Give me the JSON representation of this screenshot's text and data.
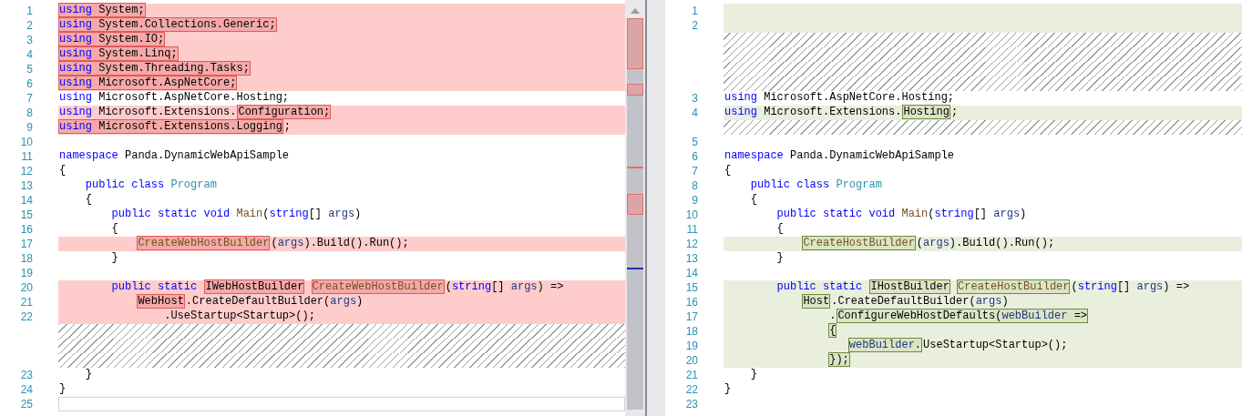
{
  "panes": [
    {
      "kind": "old",
      "lines": [
        {
          "kind": "removed",
          "num": "1",
          "segments": [
            {
              "changed": true,
              "tokens": [
                {
                  "t": "using",
                  "kind": "kw"
                },
                {
                  "t": " System;",
                  "kind": "plain"
                }
              ]
            }
          ]
        },
        {
          "kind": "removed",
          "num": "2",
          "segments": [
            {
              "changed": true,
              "tokens": [
                {
                  "t": "using",
                  "kind": "kw"
                },
                {
                  "t": " System.Collections.Generic;",
                  "kind": "plain"
                }
              ]
            }
          ]
        },
        {
          "kind": "removed",
          "num": "3",
          "segments": [
            {
              "changed": true,
              "tokens": [
                {
                  "t": "using",
                  "kind": "kw"
                },
                {
                  "t": " System.IO;",
                  "kind": "plain"
                }
              ]
            }
          ]
        },
        {
          "kind": "removed",
          "num": "4",
          "segments": [
            {
              "changed": true,
              "tokens": [
                {
                  "t": "using",
                  "kind": "kw"
                },
                {
                  "t": " System.Linq;",
                  "kind": "plain"
                }
              ]
            }
          ]
        },
        {
          "kind": "removed",
          "num": "5",
          "segments": [
            {
              "changed": true,
              "tokens": [
                {
                  "t": "using",
                  "kind": "kw"
                },
                {
                  "t": " System.Threading.Tasks;",
                  "kind": "plain"
                }
              ]
            }
          ]
        },
        {
          "kind": "removed",
          "num": "6",
          "segments": [
            {
              "changed": true,
              "tokens": [
                {
                  "t": "using",
                  "kind": "kw"
                },
                {
                  "t": " Microsoft.AspNetCore;",
                  "kind": "plain"
                }
              ]
            }
          ]
        },
        {
          "kind": "same",
          "num": "7",
          "segments": [
            {
              "changed": false,
              "tokens": [
                {
                  "t": "using",
                  "kind": "kw"
                },
                {
                  "t": " Microsoft.AspNetCore.Hosting;",
                  "kind": "plain"
                }
              ]
            }
          ]
        },
        {
          "kind": "removed",
          "num": "8",
          "segments": [
            {
              "changed": false,
              "tokens": [
                {
                  "t": "using",
                  "kind": "kw"
                },
                {
                  "t": " Microsoft.Extensions.",
                  "kind": "plain"
                }
              ]
            },
            {
              "changed": true,
              "tokens": [
                {
                  "t": "Configuration;",
                  "kind": "plain"
                }
              ]
            }
          ]
        },
        {
          "kind": "removed",
          "num": "9",
          "segments": [
            {
              "changed": true,
              "tokens": [
                {
                  "t": "using",
                  "kind": "kw"
                },
                {
                  "t": " Microsoft.Extensions.Logging",
                  "kind": "plain"
                }
              ]
            },
            {
              "changed": false,
              "tokens": [
                {
                  "t": ";",
                  "kind": "plain"
                }
              ]
            }
          ]
        },
        {
          "kind": "same",
          "num": "10"
        },
        {
          "kind": "same",
          "num": "11",
          "segments": [
            {
              "changed": false,
              "tokens": [
                {
                  "t": "namespace",
                  "kind": "kw"
                },
                {
                  "t": " Panda.DynamicWebApiSample",
                  "kind": "plain"
                }
              ]
            }
          ]
        },
        {
          "kind": "same",
          "num": "12",
          "segments": [
            {
              "changed": false,
              "tokens": [
                {
                  "t": "{",
                  "kind": "plain"
                }
              ]
            }
          ]
        },
        {
          "kind": "same",
          "num": "13",
          "segments": [
            {
              "changed": false,
              "tokens": [
                {
                  "t": "    public class ",
                  "kind": "kw"
                },
                {
                  "t": "Program",
                  "kind": "type"
                }
              ]
            }
          ]
        },
        {
          "kind": "same",
          "num": "14",
          "segments": [
            {
              "changed": false,
              "tokens": [
                {
                  "t": "    {",
                  "kind": "plain"
                }
              ]
            }
          ]
        },
        {
          "kind": "same",
          "num": "15",
          "segments": [
            {
              "changed": false,
              "tokens": [
                {
                  "t": "        public static void ",
                  "kind": "kw"
                },
                {
                  "t": "Main",
                  "kind": "method"
                },
                {
                  "t": "(",
                  "kind": "plain"
                },
                {
                  "t": "string",
                  "kind": "kw"
                },
                {
                  "t": "[] ",
                  "kind": "plain"
                },
                {
                  "t": "args",
                  "kind": "param"
                },
                {
                  "t": ")",
                  "kind": "plain"
                }
              ]
            }
          ]
        },
        {
          "kind": "same",
          "num": "16",
          "segments": [
            {
              "changed": false,
              "tokens": [
                {
                  "t": "        {",
                  "kind": "plain"
                }
              ]
            }
          ]
        },
        {
          "kind": "removed",
          "num": "17",
          "segments": [
            {
              "changed": true,
              "tokens": [
                {
                  "t": "            CreateWebHostBuilder",
                  "kind": "method"
                }
              ]
            },
            {
              "changed": false,
              "tokens": [
                {
                  "t": "(",
                  "kind": "plain"
                },
                {
                  "t": "args",
                  "kind": "param"
                },
                {
                  "t": ").Build().Run();",
                  "kind": "plain"
                }
              ]
            }
          ]
        },
        {
          "kind": "same",
          "num": "18",
          "segments": [
            {
              "changed": false,
              "tokens": [
                {
                  "t": "        }",
                  "kind": "plain"
                }
              ]
            }
          ]
        },
        {
          "kind": "same",
          "num": "19"
        },
        {
          "kind": "removed",
          "num": "20",
          "segments": [
            {
              "changed": false,
              "tokens": [
                {
                  "t": "        public static ",
                  "kind": "kw"
                }
              ]
            },
            {
              "changed": true,
              "tokens": [
                {
                  "t": "IWebHostBuilder",
                  "kind": "plain"
                }
              ]
            },
            {
              "changed": true,
              "tokens": [
                {
                  "t": " CreateWebHostBuilder",
                  "kind": "method"
                }
              ]
            },
            {
              "changed": false,
              "tokens": [
                {
                  "t": "(",
                  "kind": "plain"
                },
                {
                  "t": "string",
                  "kind": "kw"
                },
                {
                  "t": "[] ",
                  "kind": "plain"
                },
                {
                  "t": "args",
                  "kind": "param"
                },
                {
                  "t": ") =>",
                  "kind": "plain"
                }
              ]
            }
          ]
        },
        {
          "kind": "removed",
          "num": "21",
          "segments": [
            {
              "changed": true,
              "tokens": [
                {
                  "t": "            WebHost",
                  "kind": "plain"
                }
              ]
            },
            {
              "changed": false,
              "tokens": [
                {
                  "t": ".CreateDefaultBuilder(",
                  "kind": "plain"
                },
                {
                  "t": "args",
                  "kind": "param"
                },
                {
                  "t": ")",
                  "kind": "plain"
                }
              ]
            }
          ]
        },
        {
          "kind": "removed",
          "num": "22",
          "segments": [
            {
              "changed": false,
              "tokens": [
                {
                  "t": "                .UseStartup<Startup>();",
                  "kind": "plain"
                }
              ]
            }
          ]
        },
        {
          "kind": "filler"
        },
        {
          "kind": "filler"
        },
        {
          "kind": "filler"
        },
        {
          "kind": "same",
          "num": "23",
          "segments": [
            {
              "changed": false,
              "tokens": [
                {
                  "t": "    }",
                  "kind": "plain"
                }
              ]
            }
          ]
        },
        {
          "kind": "same",
          "num": "24",
          "segments": [
            {
              "changed": false,
              "tokens": [
                {
                  "t": "}",
                  "kind": "plain"
                }
              ]
            }
          ]
        },
        {
          "kind": "current",
          "num": "25"
        }
      ]
    },
    {
      "kind": "new",
      "lines": [
        {
          "kind": "added",
          "num": "1"
        },
        {
          "kind": "added",
          "num": "2"
        },
        {
          "kind": "filler"
        },
        {
          "kind": "filler"
        },
        {
          "kind": "filler"
        },
        {
          "kind": "filler"
        },
        {
          "kind": "same",
          "num": "3",
          "segments": [
            {
              "changed": false,
              "tokens": [
                {
                  "t": "using",
                  "kind": "kw"
                },
                {
                  "t": " Microsoft.AspNetCore.Hosting;",
                  "kind": "plain"
                }
              ]
            }
          ]
        },
        {
          "kind": "added",
          "num": "4",
          "segments": [
            {
              "changed": false,
              "tokens": [
                {
                  "t": "using",
                  "kind": "kw"
                },
                {
                  "t": " Microsoft.Extensions.",
                  "kind": "plain"
                }
              ]
            },
            {
              "changed": true,
              "tokens": [
                {
                  "t": "Hosting",
                  "kind": "plain"
                }
              ]
            },
            {
              "changed": false,
              "tokens": [
                {
                  "t": ";",
                  "kind": "plain"
                }
              ]
            }
          ]
        },
        {
          "kind": "filler"
        },
        {
          "kind": "same",
          "num": "5"
        },
        {
          "kind": "same",
          "num": "6",
          "segments": [
            {
              "changed": false,
              "tokens": [
                {
                  "t": "namespace",
                  "kind": "kw"
                },
                {
                  "t": " Panda.DynamicWebApiSample",
                  "kind": "plain"
                }
              ]
            }
          ]
        },
        {
          "kind": "same",
          "num": "7",
          "segments": [
            {
              "changed": false,
              "tokens": [
                {
                  "t": "{",
                  "kind": "plain"
                }
              ]
            }
          ]
        },
        {
          "kind": "same",
          "num": "8",
          "segments": [
            {
              "changed": false,
              "tokens": [
                {
                  "t": "    public class ",
                  "kind": "kw"
                },
                {
                  "t": "Program",
                  "kind": "type"
                }
              ]
            }
          ]
        },
        {
          "kind": "same",
          "num": "9",
          "segments": [
            {
              "changed": false,
              "tokens": [
                {
                  "t": "    {",
                  "kind": "plain"
                }
              ]
            }
          ]
        },
        {
          "kind": "same",
          "num": "10",
          "segments": [
            {
              "changed": false,
              "tokens": [
                {
                  "t": "        public static void ",
                  "kind": "kw"
                },
                {
                  "t": "Main",
                  "kind": "method"
                },
                {
                  "t": "(",
                  "kind": "plain"
                },
                {
                  "t": "string",
                  "kind": "kw"
                },
                {
                  "t": "[] ",
                  "kind": "plain"
                },
                {
                  "t": "args",
                  "kind": "param"
                },
                {
                  "t": ")",
                  "kind": "plain"
                }
              ]
            }
          ]
        },
        {
          "kind": "same",
          "num": "11",
          "segments": [
            {
              "changed": false,
              "tokens": [
                {
                  "t": "        {",
                  "kind": "plain"
                }
              ]
            }
          ]
        },
        {
          "kind": "added",
          "num": "12",
          "segments": [
            {
              "changed": true,
              "tokens": [
                {
                  "t": "            CreateHostBuilder",
                  "kind": "method"
                }
              ]
            },
            {
              "changed": false,
              "tokens": [
                {
                  "t": "(",
                  "kind": "plain"
                },
                {
                  "t": "args",
                  "kind": "param"
                },
                {
                  "t": ").Build().Run();",
                  "kind": "plain"
                }
              ]
            }
          ]
        },
        {
          "kind": "same",
          "num": "13",
          "segments": [
            {
              "changed": false,
              "tokens": [
                {
                  "t": "        }",
                  "kind": "plain"
                }
              ]
            }
          ]
        },
        {
          "kind": "same",
          "num": "14"
        },
        {
          "kind": "added",
          "num": "15",
          "segments": [
            {
              "changed": false,
              "tokens": [
                {
                  "t": "        public static ",
                  "kind": "kw"
                }
              ]
            },
            {
              "changed": true,
              "tokens": [
                {
                  "t": "IHostBuilder",
                  "kind": "plain"
                }
              ]
            },
            {
              "changed": true,
              "tokens": [
                {
                  "t": " CreateHostBuilder",
                  "kind": "method"
                }
              ]
            },
            {
              "changed": false,
              "tokens": [
                {
                  "t": "(",
                  "kind": "plain"
                },
                {
                  "t": "string",
                  "kind": "kw"
                },
                {
                  "t": "[] ",
                  "kind": "plain"
                },
                {
                  "t": "args",
                  "kind": "param"
                },
                {
                  "t": ") =>",
                  "kind": "plain"
                }
              ]
            }
          ]
        },
        {
          "kind": "added",
          "num": "16",
          "segments": [
            {
              "changed": true,
              "tokens": [
                {
                  "t": "            Host",
                  "kind": "plain"
                }
              ]
            },
            {
              "changed": false,
              "tokens": [
                {
                  "t": ".CreateDefaultBuilder(",
                  "kind": "plain"
                },
                {
                  "t": "args",
                  "kind": "param"
                },
                {
                  "t": ")",
                  "kind": "plain"
                }
              ]
            }
          ]
        },
        {
          "kind": "added",
          "num": "17",
          "segments": [
            {
              "changed": false,
              "tokens": [
                {
                  "t": "                .",
                  "kind": "plain"
                }
              ]
            },
            {
              "changed": true,
              "tokens": [
                {
                  "t": "ConfigureWebHostDefaults(",
                  "kind": "plain"
                },
                {
                  "t": "webBuilder",
                  "kind": "param"
                },
                {
                  "t": " =>",
                  "kind": "plain"
                }
              ]
            }
          ]
        },
        {
          "kind": "added",
          "num": "18",
          "segments": [
            {
              "changed": true,
              "tokens": [
                {
                  "t": "                {",
                  "kind": "plain"
                }
              ]
            }
          ]
        },
        {
          "kind": "added",
          "num": "19",
          "segments": [
            {
              "changed": true,
              "tokens": [
                {
                  "t": "                   webBuilder",
                  "kind": "param"
                },
                {
                  "t": ".",
                  "kind": "plain"
                }
              ]
            },
            {
              "changed": false,
              "tokens": [
                {
                  "t": "UseStartup<Startup>();",
                  "kind": "plain"
                }
              ]
            }
          ]
        },
        {
          "kind": "added",
          "num": "20",
          "segments": [
            {
              "changed": true,
              "tokens": [
                {
                  "t": "                });",
                  "kind": "plain"
                }
              ]
            }
          ]
        },
        {
          "kind": "same",
          "num": "21",
          "segments": [
            {
              "changed": false,
              "tokens": [
                {
                  "t": "    }",
                  "kind": "plain"
                }
              ]
            }
          ]
        },
        {
          "kind": "same",
          "num": "22",
          "segments": [
            {
              "changed": false,
              "tokens": [
                {
                  "t": "}",
                  "kind": "plain"
                }
              ]
            }
          ]
        },
        {
          "kind": "same",
          "num": "23"
        }
      ]
    }
  ]
}
